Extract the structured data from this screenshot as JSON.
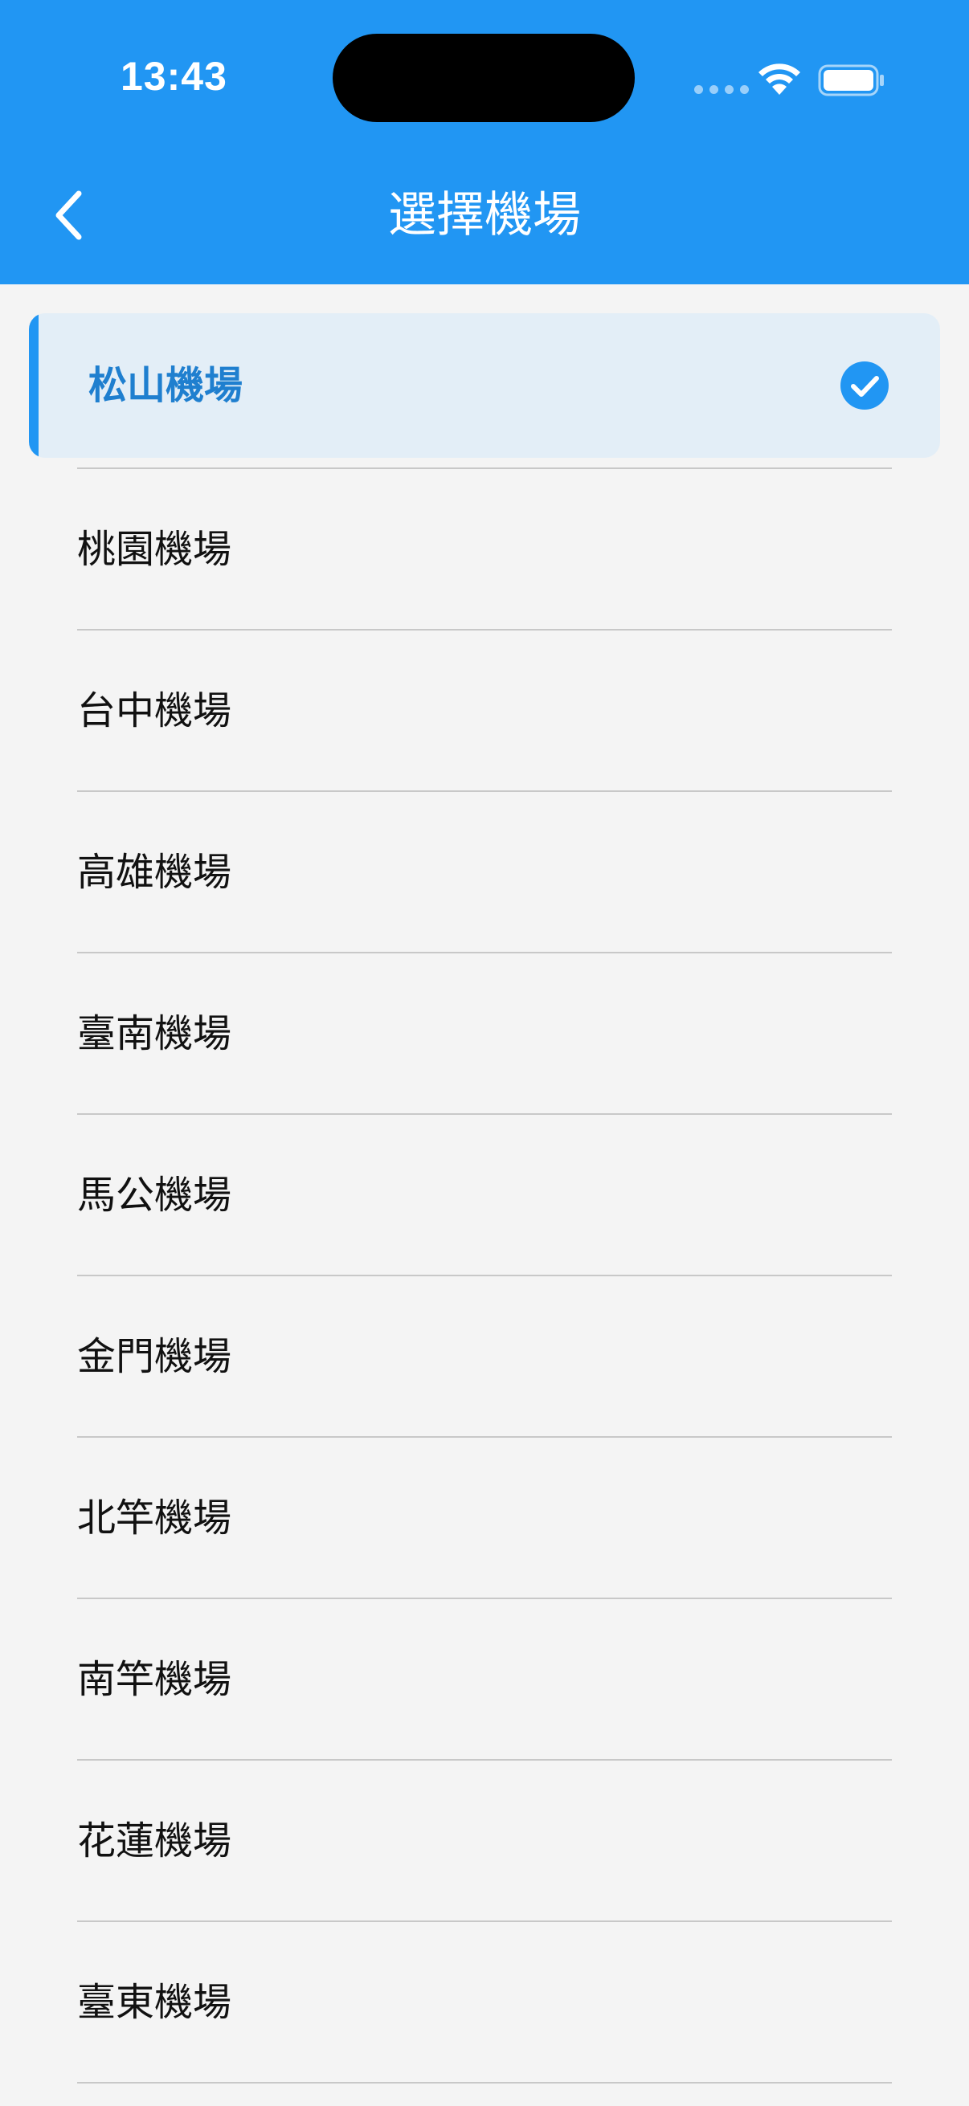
{
  "status_bar": {
    "time": "13:43"
  },
  "nav": {
    "title": "選擇機場",
    "back_icon": "chevron-left-icon"
  },
  "colors": {
    "primary": "#2196f3",
    "selected_bg": "#e3eef7",
    "selected_text": "#1f7fcf",
    "background": "#f4f4f4"
  },
  "airports": {
    "selected": "松山機場",
    "items": [
      "松山機場",
      "桃園機場",
      "台中機場",
      "高雄機場",
      "臺南機場",
      "馬公機場",
      "金門機場",
      "北竿機場",
      "南竿機場",
      "花蓮機場",
      "臺東機場"
    ]
  }
}
